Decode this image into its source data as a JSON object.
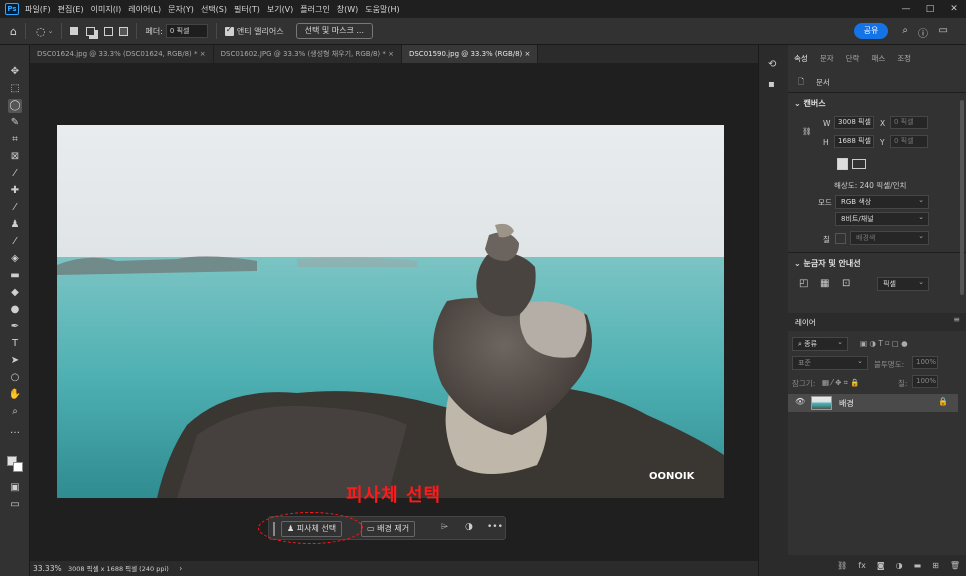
{
  "app": {
    "logo": "Ps"
  },
  "menu": [
    "파일(F)",
    "편집(E)",
    "이미지(I)",
    "레이어(L)",
    "문자(Y)",
    "선택(S)",
    "필터(T)",
    "보기(V)",
    "플러그인",
    "창(W)",
    "도움말(H)"
  ],
  "window_controls": {
    "minimize": "—",
    "restore": "□",
    "close": "✕"
  },
  "options": {
    "feather_label": "페더:",
    "feather_value": "0 픽셀",
    "anti_alias": "앤티 앨리어스",
    "select_mask": "선택 및 마스크 ...",
    "share": "공유"
  },
  "tabs": [
    {
      "label": "DSC01624.jpg @ 33.3% (DSC01624, RGB/8) *",
      "close": "×"
    },
    {
      "label": "DSC01602.JPG @ 33.3% (생성형 채우기, RGB/8) *",
      "close": "×"
    },
    {
      "label": "DSC01590.jpg @ 33.3% (RGB/8)",
      "close": "×"
    }
  ],
  "annotation": {
    "text": "피사체 선택",
    "color": "#ff1a1a"
  },
  "context_bar": {
    "select_subject": "피사체 선택",
    "remove_bg": "배경 제거",
    "more": "•••"
  },
  "status": {
    "zoom": "33.33%",
    "info": "3008 픽셀 x 1688 픽셀 (240 ppi)",
    "arrow": "›"
  },
  "properties_panel": {
    "tabs": [
      "속성",
      "문자",
      "단락",
      "패스",
      "조정"
    ],
    "doc_label": "문서",
    "canvas_title": "캔버스",
    "w_label": "W",
    "w_value": "3008 픽셀",
    "h_label": "H",
    "h_value": "1688 픽셀",
    "x_label": "X",
    "x_value": "0 픽셀",
    "y_label": "Y",
    "y_value": "0 픽셀",
    "resolution": "해상도: 240 픽셀/인치",
    "mode_label": "모드",
    "mode_value": "RGB 색상",
    "bit_value": "8비트/채널",
    "fill_label": "칠",
    "fill_value": "배경색",
    "guides_title": "눈금자 및 안내선",
    "units_value": "픽셀"
  },
  "layers_panel": {
    "tab": "레이어",
    "kind_filter": "종류",
    "blend_mode": "표준",
    "opacity_label": "불투명도:",
    "opacity_value": "100%",
    "lock_label": "잠그기:",
    "fill_label": "칠:",
    "fill_value": "100%",
    "layer_name": "배경"
  },
  "colors": {
    "accent": "#1473e6",
    "annotation": "#ff1a1a",
    "panel": "#323232"
  }
}
